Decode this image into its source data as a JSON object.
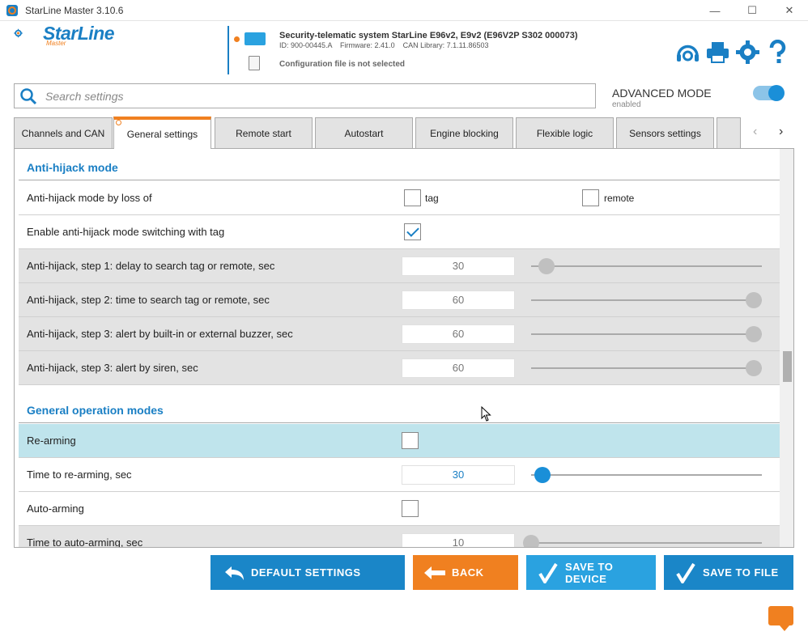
{
  "window": {
    "title": "StarLine Master 3.10.6",
    "minimize": "—",
    "maximize": "☐",
    "close": "✕"
  },
  "logo": {
    "brand": "StarLine",
    "sub": "Master"
  },
  "device": {
    "title": "Security-telematic system StarLine E96v2, E9v2 (E96V2P S302 000073)",
    "info": "ID: 900-00445.A    Firmware: 2.41.0    CAN Library: 7.1.11.86503",
    "config": "Configuration file is not selected"
  },
  "header_icons": [
    "support-icon",
    "print-icon",
    "gear-icon",
    "help-icon"
  ],
  "search": {
    "placeholder": "Search settings"
  },
  "advanced": {
    "label": "ADVANCED MODE",
    "status": "enabled",
    "on": true
  },
  "tabs": [
    {
      "label": "Channels and CAN"
    },
    {
      "label": "General settings",
      "active": true
    },
    {
      "label": "Remote start"
    },
    {
      "label": "Autostart"
    },
    {
      "label": "Engine blocking"
    },
    {
      "label": "Flexible logic"
    },
    {
      "label": "Sensors settings"
    },
    {
      "label": ""
    }
  ],
  "tab_nav": {
    "prev": "‹",
    "next": "›"
  },
  "sections": {
    "anti_hijack": {
      "title": "Anti-hijack mode",
      "rows": {
        "loss": {
          "label": "Anti-hijack mode by loss of",
          "opt1": "tag",
          "opt2": "remote",
          "opt1_checked": false,
          "opt2_checked": false
        },
        "switch_tag": {
          "label": "Enable anti-hijack mode switching with tag",
          "checked": true
        },
        "step1": {
          "label": "Anti-hijack, step 1: delay to search tag or remote, sec",
          "value": "30",
          "fraction": 0.07
        },
        "step2": {
          "label": "Anti-hijack, step 2: time to search tag or remote, sec",
          "value": "60",
          "fraction": 1.0
        },
        "step3_buzzer": {
          "label": "Anti-hijack, step 3: alert by built-in or external buzzer, sec",
          "value": "60",
          "fraction": 1.0
        },
        "step3_siren": {
          "label": "Anti-hijack, step 3: alert by siren, sec",
          "value": "60",
          "fraction": 1.0
        }
      }
    },
    "general": {
      "title": "General operation modes",
      "rows": {
        "rearming": {
          "label": "Re-arming",
          "checked": false
        },
        "rearm_time": {
          "label": "Time to re-arming, sec",
          "value": "30",
          "fraction": 0.05
        },
        "autoarming": {
          "label": "Auto-arming",
          "checked": false
        },
        "autoarm_time": {
          "label": "Time to auto-arming, sec",
          "value": "10",
          "fraction": 0.0
        }
      }
    }
  },
  "buttons": {
    "default": "DEFAULT SETTINGS",
    "back": "BACK",
    "save_device": "SAVE TO DEVICE",
    "save_file": "SAVE TO FILE"
  },
  "colors": {
    "brand_blue": "#1a7fc4",
    "button_blue": "#1a86c8",
    "accent_orange": "#f08020"
  }
}
